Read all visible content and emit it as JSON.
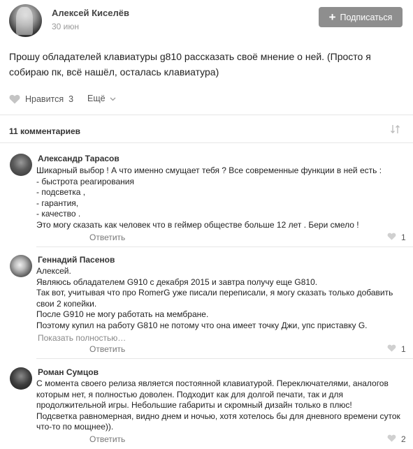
{
  "post": {
    "author": "Алексей Киселёв",
    "date": "30 июн",
    "subscribe_label": "Подписаться",
    "text": "Прошу обладателей клавиатуры g810 рассказать своё мнение о ней. (Просто я собираю пк, всё нашёл, осталась клавиатура)",
    "like_label": "Нравится",
    "like_count": "3",
    "more_label": "Ещё"
  },
  "comments_header": {
    "count_label": "11 комментариев"
  },
  "comments": [
    {
      "author": "Александр Тарасов",
      "text": "Шикарный выбор ! А что именно смущает тебя ? Все современные функции в ней есть :\n- быстрота реагирования\n- подсветка ,\n- гарантия,\n- качество .\nЭто могу сказать как человек что в геймер обществе больше 12 лет . Бери смело !",
      "reply_label": "Ответить",
      "likes": "1"
    },
    {
      "author": "Геннадий Пасенов",
      "text": "Алексей.\nЯвляюсь обладателем G910 с декабря 2015 и завтра получу еще G810.\nТак вот, учитывая что про RomerG уже писали переписали, я могу сказать только добавить свои 2 копейки.\nПосле G910 не могу работать на мембране.\nПоэтому купил на работу G810 не потому что она имеет точку Джи, упс приставку G.",
      "show_more_label": "Показать полностью…",
      "reply_label": "Ответить",
      "likes": "1"
    },
    {
      "author": "Роман Сумцов",
      "text": "С момента своего релиза является постоянной клавиатурой. Переключателями, аналогов которым нет, я полностью доволен. Подходит как для долгой печати, так и для продолжительной игры. Небольшие габариты и скромный дизайн только в плюс!\nПодсветка равномерная, видно днем и ночью, хотя хотелось бы для дневного времени суток что-то по мощнее)).",
      "reply_label": "Ответить",
      "likes": "2"
    }
  ],
  "icons": {
    "heart": "heart-icon",
    "plus": "plus-icon",
    "chevron": "chevron-down-icon",
    "sort": "sort-icon"
  },
  "colors": {
    "button_bg": "#8e8e8e",
    "text": "#222222",
    "muted": "#777777",
    "separator": "#e6e6e6"
  }
}
